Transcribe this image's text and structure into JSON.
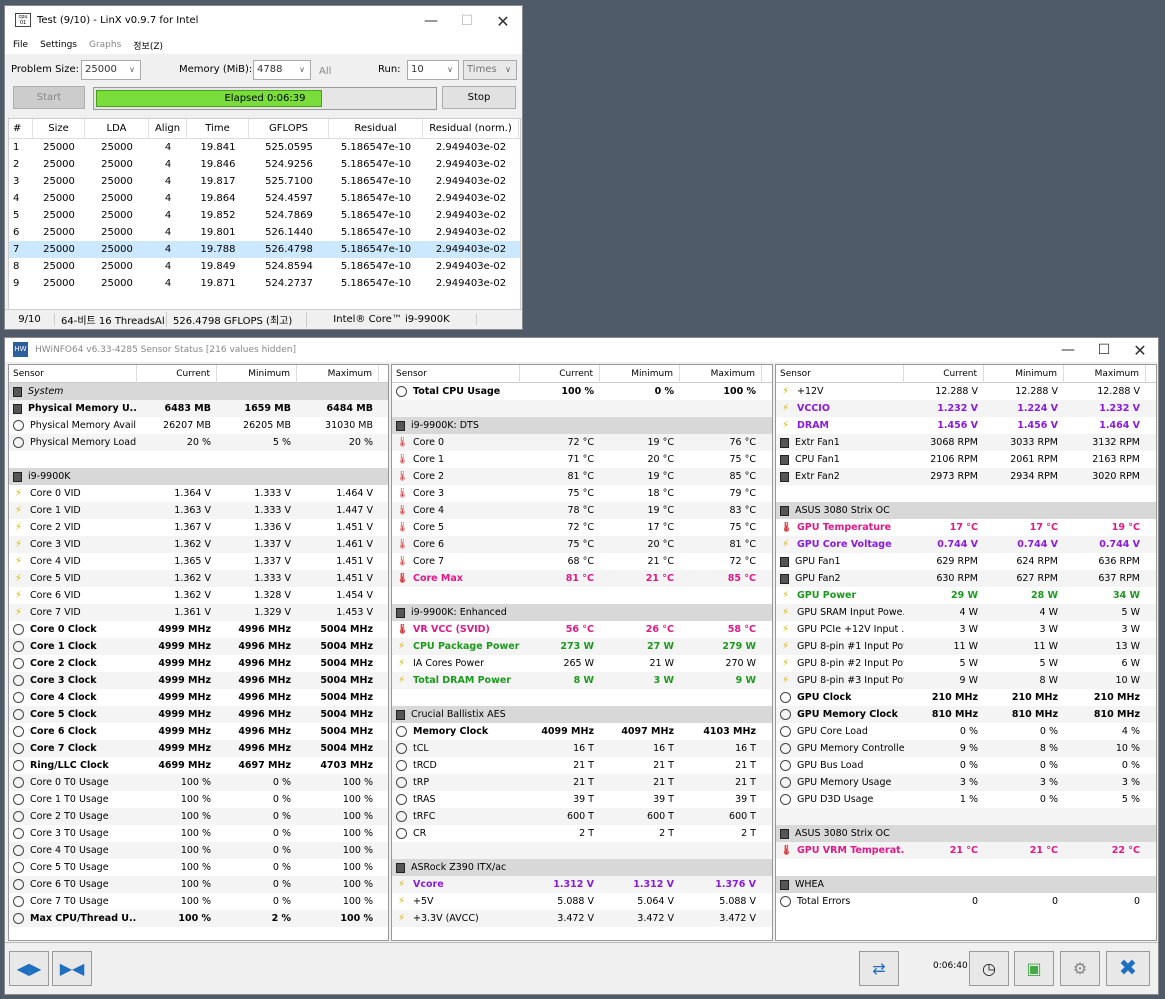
{
  "linx": {
    "title": "Test (9/10) - LinX v0.9.7 for Intel",
    "menu": [
      "File",
      "Settings",
      "Graphs",
      "정보(Z)"
    ],
    "problem_size_label": "Problem Size:",
    "problem_size": "25000",
    "memory_label": "Memory (MiB):",
    "memory": "4788",
    "all_label": "All",
    "run_label": "Run:",
    "run": "10",
    "times": "Times",
    "start": "Start",
    "progress_text": "Elapsed 0:06:39",
    "progress": 0.66,
    "stop": "Stop",
    "columns": [
      "#",
      "Size",
      "LDA",
      "Align",
      "Time",
      "GFLOPS",
      "Residual",
      "Residual (norm.)"
    ],
    "rows": [
      [
        "1",
        "25000",
        "25000",
        "4",
        "19.841",
        "525.0595",
        "5.186547e-10",
        "2.949403e-02"
      ],
      [
        "2",
        "25000",
        "25000",
        "4",
        "19.846",
        "524.9256",
        "5.186547e-10",
        "2.949403e-02"
      ],
      [
        "3",
        "25000",
        "25000",
        "4",
        "19.817",
        "525.7100",
        "5.186547e-10",
        "2.949403e-02"
      ],
      [
        "4",
        "25000",
        "25000",
        "4",
        "19.864",
        "524.4597",
        "5.186547e-10",
        "2.949403e-02"
      ],
      [
        "5",
        "25000",
        "25000",
        "4",
        "19.852",
        "524.7869",
        "5.186547e-10",
        "2.949403e-02"
      ],
      [
        "6",
        "25000",
        "25000",
        "4",
        "19.801",
        "526.1440",
        "5.186547e-10",
        "2.949403e-02"
      ],
      [
        "7",
        "25000",
        "25000",
        "4",
        "19.788",
        "526.4798",
        "5.186547e-10",
        "2.949403e-02"
      ],
      [
        "8",
        "25000",
        "25000",
        "4",
        "19.849",
        "524.8594",
        "5.186547e-10",
        "2.949403e-02"
      ],
      [
        "9",
        "25000",
        "25000",
        "4",
        "19.871",
        "524.2737",
        "5.186547e-10",
        "2.949403e-02"
      ]
    ],
    "selected_row": 6,
    "status": [
      "9/10",
      "64-비트  16 ThreadsAl",
      "526.4798 GFLOPS (최고)",
      "Intel® Core™ i9-9900K"
    ]
  },
  "hw": {
    "title": "HWiNFO64 v6.33-4285 Sensor Status [216 values hidden]",
    "headers": [
      "Sensor",
      "Current",
      "Minimum",
      "Maximum"
    ],
    "panes": [
      [
        {
          "g": "System",
          "it": true
        },
        {
          "i": "chip",
          "n": "Physical Memory U...",
          "c": "6483 MB",
          "mi": "1659 MB",
          "ma": "6484 MB",
          "b": true
        },
        {
          "i": "clock",
          "n": "Physical Memory Avail...",
          "c": "26207 MB",
          "mi": "26205 MB",
          "ma": "31030 MB"
        },
        {
          "i": "clock",
          "n": "Physical Memory Load",
          "c": "20 %",
          "mi": "5 %",
          "ma": "20 %"
        },
        {
          "e": true
        },
        {
          "g": "i9-9900K"
        },
        {
          "i": "bolt",
          "n": "Core 0 VID",
          "c": "1.364 V",
          "mi": "1.333 V",
          "ma": "1.464 V"
        },
        {
          "i": "bolt",
          "n": "Core 1 VID",
          "c": "1.363 V",
          "mi": "1.333 V",
          "ma": "1.447 V"
        },
        {
          "i": "bolt",
          "n": "Core 2 VID",
          "c": "1.367 V",
          "mi": "1.336 V",
          "ma": "1.451 V"
        },
        {
          "i": "bolt",
          "n": "Core 3 VID",
          "c": "1.362 V",
          "mi": "1.337 V",
          "ma": "1.461 V"
        },
        {
          "i": "bolt",
          "n": "Core 4 VID",
          "c": "1.365 V",
          "mi": "1.337 V",
          "ma": "1.451 V"
        },
        {
          "i": "bolt",
          "n": "Core 5 VID",
          "c": "1.362 V",
          "mi": "1.333 V",
          "ma": "1.451 V"
        },
        {
          "i": "bolt",
          "n": "Core 6 VID",
          "c": "1.362 V",
          "mi": "1.328 V",
          "ma": "1.454 V"
        },
        {
          "i": "bolt",
          "n": "Core 7 VID",
          "c": "1.361 V",
          "mi": "1.329 V",
          "ma": "1.453 V"
        },
        {
          "i": "clock",
          "n": "Core 0 Clock",
          "c": "4999 MHz",
          "mi": "4996 MHz",
          "ma": "5004 MHz",
          "b": true
        },
        {
          "i": "clock",
          "n": "Core 1 Clock",
          "c": "4999 MHz",
          "mi": "4996 MHz",
          "ma": "5004 MHz",
          "b": true
        },
        {
          "i": "clock",
          "n": "Core 2 Clock",
          "c": "4999 MHz",
          "mi": "4996 MHz",
          "ma": "5004 MHz",
          "b": true
        },
        {
          "i": "clock",
          "n": "Core 3 Clock",
          "c": "4999 MHz",
          "mi": "4996 MHz",
          "ma": "5004 MHz",
          "b": true
        },
        {
          "i": "clock",
          "n": "Core 4 Clock",
          "c": "4999 MHz",
          "mi": "4996 MHz",
          "ma": "5004 MHz",
          "b": true
        },
        {
          "i": "clock",
          "n": "Core 5 Clock",
          "c": "4999 MHz",
          "mi": "4996 MHz",
          "ma": "5004 MHz",
          "b": true
        },
        {
          "i": "clock",
          "n": "Core 6 Clock",
          "c": "4999 MHz",
          "mi": "4996 MHz",
          "ma": "5004 MHz",
          "b": true
        },
        {
          "i": "clock",
          "n": "Core 7 Clock",
          "c": "4999 MHz",
          "mi": "4996 MHz",
          "ma": "5004 MHz",
          "b": true
        },
        {
          "i": "clock",
          "n": "Ring/LLC Clock",
          "c": "4699 MHz",
          "mi": "4697 MHz",
          "ma": "4703 MHz",
          "b": true
        },
        {
          "i": "clock",
          "n": "Core 0 T0 Usage",
          "c": "100 %",
          "mi": "0 %",
          "ma": "100 %"
        },
        {
          "i": "clock",
          "n": "Core 1 T0 Usage",
          "c": "100 %",
          "mi": "0 %",
          "ma": "100 %"
        },
        {
          "i": "clock",
          "n": "Core 2 T0 Usage",
          "c": "100 %",
          "mi": "0 %",
          "ma": "100 %"
        },
        {
          "i": "clock",
          "n": "Core 3 T0 Usage",
          "c": "100 %",
          "mi": "0 %",
          "ma": "100 %"
        },
        {
          "i": "clock",
          "n": "Core 4 T0 Usage",
          "c": "100 %",
          "mi": "0 %",
          "ma": "100 %"
        },
        {
          "i": "clock",
          "n": "Core 5 T0 Usage",
          "c": "100 %",
          "mi": "0 %",
          "ma": "100 %"
        },
        {
          "i": "clock",
          "n": "Core 6 T0 Usage",
          "c": "100 %",
          "mi": "0 %",
          "ma": "100 %"
        },
        {
          "i": "clock",
          "n": "Core 7 T0 Usage",
          "c": "100 %",
          "mi": "0 %",
          "ma": "100 %"
        },
        {
          "i": "clock",
          "n": "Max CPU/Thread U...",
          "c": "100 %",
          "mi": "2 %",
          "ma": "100 %",
          "b": true
        }
      ],
      [
        {
          "i": "clock",
          "n": "Total CPU Usage",
          "c": "100 %",
          "mi": "0 %",
          "ma": "100 %",
          "b": true
        },
        {
          "e": true
        },
        {
          "g": "i9-9900K: DTS"
        },
        {
          "i": "therm",
          "n": "Core 0",
          "c": "72 °C",
          "mi": "19 °C",
          "ma": "76 °C"
        },
        {
          "i": "therm",
          "n": "Core 1",
          "c": "71 °C",
          "mi": "20 °C",
          "ma": "75 °C"
        },
        {
          "i": "therm",
          "n": "Core 2",
          "c": "81 °C",
          "mi": "19 °C",
          "ma": "85 °C"
        },
        {
          "i": "therm",
          "n": "Core 3",
          "c": "75 °C",
          "mi": "18 °C",
          "ma": "79 °C"
        },
        {
          "i": "therm",
          "n": "Core 4",
          "c": "78 °C",
          "mi": "19 °C",
          "ma": "83 °C"
        },
        {
          "i": "therm",
          "n": "Core 5",
          "c": "72 °C",
          "mi": "17 °C",
          "ma": "75 °C"
        },
        {
          "i": "therm",
          "n": "Core 6",
          "c": "75 °C",
          "mi": "20 °C",
          "ma": "81 °C"
        },
        {
          "i": "therm",
          "n": "Core 7",
          "c": "68 °C",
          "mi": "21 °C",
          "ma": "72 °C"
        },
        {
          "i": "therm",
          "n": "Core Max",
          "c": "81 °C",
          "mi": "21 °C",
          "ma": "85 °C",
          "b": true,
          "col": "#e0188a"
        },
        {
          "e": true
        },
        {
          "g": "i9-9900K: Enhanced"
        },
        {
          "i": "therm",
          "n": "VR VCC (SVID)",
          "c": "56 °C",
          "mi": "26 °C",
          "ma": "58 °C",
          "b": true,
          "col": "#e0188a"
        },
        {
          "i": "bolt",
          "n": "CPU Package Power",
          "c": "273 W",
          "mi": "27 W",
          "ma": "279 W",
          "b": true,
          "col": "#1a9a1a"
        },
        {
          "i": "bolt",
          "n": "IA Cores Power",
          "c": "265 W",
          "mi": "21 W",
          "ma": "270 W"
        },
        {
          "i": "bolt",
          "n": "Total DRAM Power",
          "c": "8 W",
          "mi": "3 W",
          "ma": "9 W",
          "b": true,
          "col": "#1a9a1a"
        },
        {
          "e": true
        },
        {
          "g": "Crucial Ballistix AES"
        },
        {
          "i": "clock",
          "n": "Memory Clock",
          "c": "4099 MHz",
          "mi": "4097 MHz",
          "ma": "4103 MHz",
          "b": true
        },
        {
          "i": "clock",
          "n": "tCL",
          "c": "16 T",
          "mi": "16 T",
          "ma": "16 T"
        },
        {
          "i": "clock",
          "n": "tRCD",
          "c": "21 T",
          "mi": "21 T",
          "ma": "21 T"
        },
        {
          "i": "clock",
          "n": "tRP",
          "c": "21 T",
          "mi": "21 T",
          "ma": "21 T"
        },
        {
          "i": "clock",
          "n": "tRAS",
          "c": "39 T",
          "mi": "39 T",
          "ma": "39 T"
        },
        {
          "i": "clock",
          "n": "tRFC",
          "c": "600 T",
          "mi": "600 T",
          "ma": "600 T"
        },
        {
          "i": "clock",
          "n": "CR",
          "c": "2 T",
          "mi": "2 T",
          "ma": "2 T"
        },
        {
          "e": true
        },
        {
          "g": "ASRock Z390 ITX/ac"
        },
        {
          "i": "bolt",
          "n": "Vcore",
          "c": "1.312 V",
          "mi": "1.312 V",
          "ma": "1.376 V",
          "b": true,
          "col": "#8a1ae0"
        },
        {
          "i": "bolt",
          "n": "+5V",
          "c": "5.088 V",
          "mi": "5.064 V",
          "ma": "5.088 V"
        },
        {
          "i": "bolt",
          "n": "+3.3V (AVCC)",
          "c": "3.472 V",
          "mi": "3.472 V",
          "ma": "3.472 V"
        }
      ],
      [
        {
          "i": "bolt",
          "n": "+12V",
          "c": "12.288 V",
          "mi": "12.288 V",
          "ma": "12.288 V"
        },
        {
          "i": "bolt",
          "n": "VCCIO",
          "c": "1.232 V",
          "mi": "1.224 V",
          "ma": "1.232 V",
          "b": true,
          "col": "#8a1ae0"
        },
        {
          "i": "bolt",
          "n": "DRAM",
          "c": "1.456 V",
          "mi": "1.456 V",
          "ma": "1.464 V",
          "b": true,
          "col": "#8a1ae0"
        },
        {
          "i": "chip",
          "n": "Extr Fan1",
          "c": "3068 RPM",
          "mi": "3033 RPM",
          "ma": "3132 RPM"
        },
        {
          "i": "chip",
          "n": "CPU Fan1",
          "c": "2106 RPM",
          "mi": "2061 RPM",
          "ma": "2163 RPM"
        },
        {
          "i": "chip",
          "n": "Extr Fan2",
          "c": "2973 RPM",
          "mi": "2934 RPM",
          "ma": "3020 RPM"
        },
        {
          "e": true
        },
        {
          "g": "ASUS 3080 Strix OC"
        },
        {
          "i": "therm",
          "n": "GPU Temperature",
          "c": "17 °C",
          "mi": "17 °C",
          "ma": "19 °C",
          "b": true,
          "col": "#e0188a"
        },
        {
          "i": "bolt",
          "n": "GPU Core Voltage",
          "c": "0.744 V",
          "mi": "0.744 V",
          "ma": "0.744 V",
          "b": true,
          "col": "#8a1ae0"
        },
        {
          "i": "chip",
          "n": "GPU Fan1",
          "c": "629 RPM",
          "mi": "624 RPM",
          "ma": "636 RPM"
        },
        {
          "i": "chip",
          "n": "GPU Fan2",
          "c": "630 RPM",
          "mi": "627 RPM",
          "ma": "637 RPM"
        },
        {
          "i": "bolt",
          "n": "GPU Power",
          "c": "29 W",
          "mi": "28 W",
          "ma": "34 W",
          "b": true,
          "col": "#1a9a1a"
        },
        {
          "i": "bolt",
          "n": "GPU SRAM Input Powe...",
          "c": "4 W",
          "mi": "4 W",
          "ma": "5 W"
        },
        {
          "i": "bolt",
          "n": "GPU PCIe +12V Input ...",
          "c": "3 W",
          "mi": "3 W",
          "ma": "3 W"
        },
        {
          "i": "bolt",
          "n": "GPU 8-pin #1 Input Power",
          "c": "11 W",
          "mi": "11 W",
          "ma": "13 W"
        },
        {
          "i": "bolt",
          "n": "GPU 8-pin #2 Input Power",
          "c": "5 W",
          "mi": "5 W",
          "ma": "6 W"
        },
        {
          "i": "bolt",
          "n": "GPU 8-pin #3 Input Power",
          "c": "9 W",
          "mi": "8 W",
          "ma": "10 W"
        },
        {
          "i": "clock",
          "n": "GPU Clock",
          "c": "210 MHz",
          "mi": "210 MHz",
          "ma": "210 MHz",
          "b": true
        },
        {
          "i": "clock",
          "n": "GPU Memory Clock",
          "c": "810 MHz",
          "mi": "810 MHz",
          "ma": "810 MHz",
          "b": true
        },
        {
          "i": "clock",
          "n": "GPU Core Load",
          "c": "0 %",
          "mi": "0 %",
          "ma": "4 %"
        },
        {
          "i": "clock",
          "n": "GPU Memory Controller ...",
          "c": "9 %",
          "mi": "8 %",
          "ma": "10 %"
        },
        {
          "i": "clock",
          "n": "GPU Bus Load",
          "c": "0 %",
          "mi": "0 %",
          "ma": "0 %"
        },
        {
          "i": "clock",
          "n": "GPU Memory Usage",
          "c": "3 %",
          "mi": "3 %",
          "ma": "3 %"
        },
        {
          "i": "clock",
          "n": "GPU D3D Usage",
          "c": "1 %",
          "mi": "0 %",
          "ma": "5 %"
        },
        {
          "e": true
        },
        {
          "g": "ASUS 3080 Strix OC"
        },
        {
          "i": "therm",
          "n": "GPU VRM Temperat...",
          "c": "21 °C",
          "mi": "21 °C",
          "ma": "22 °C",
          "b": true,
          "col": "#e0188a"
        },
        {
          "e": true
        },
        {
          "g": "WHEA"
        },
        {
          "i": "clock",
          "n": "Total Errors",
          "c": "0",
          "mi": "0",
          "ma": "0"
        }
      ]
    ],
    "timer": "0:06:40"
  }
}
